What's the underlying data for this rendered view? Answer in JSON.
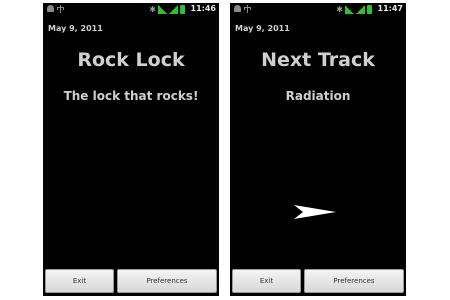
{
  "screens": [
    {
      "status_bar": {
        "time": "11:46",
        "icons": [
          "android-icon",
          "usb-icon",
          "bluetooth-icon",
          "wifi-icon",
          "signal-icon",
          "battery-icon"
        ]
      },
      "date": "May 9, 2011",
      "title": "Rock Lock",
      "subtitle": "The lock that rocks!",
      "buttons": {
        "exit": "Exit",
        "preferences": "Preferences"
      }
    },
    {
      "status_bar": {
        "time": "11:47",
        "icons": [
          "android-icon",
          "usb-icon",
          "bluetooth-icon",
          "wifi-icon",
          "signal-icon",
          "battery-icon"
        ]
      },
      "date": "May 9, 2011",
      "title": "Next Track",
      "subtitle": "Radiation",
      "gesture_icon": "arrow-right-icon",
      "buttons": {
        "exit": "Exit",
        "preferences": "Preferences"
      }
    }
  ],
  "colors": {
    "screen_background": "#000000",
    "text": "#d0d0d0",
    "status_green": "#2fbf2f",
    "button_face": "#e6e6e6"
  }
}
